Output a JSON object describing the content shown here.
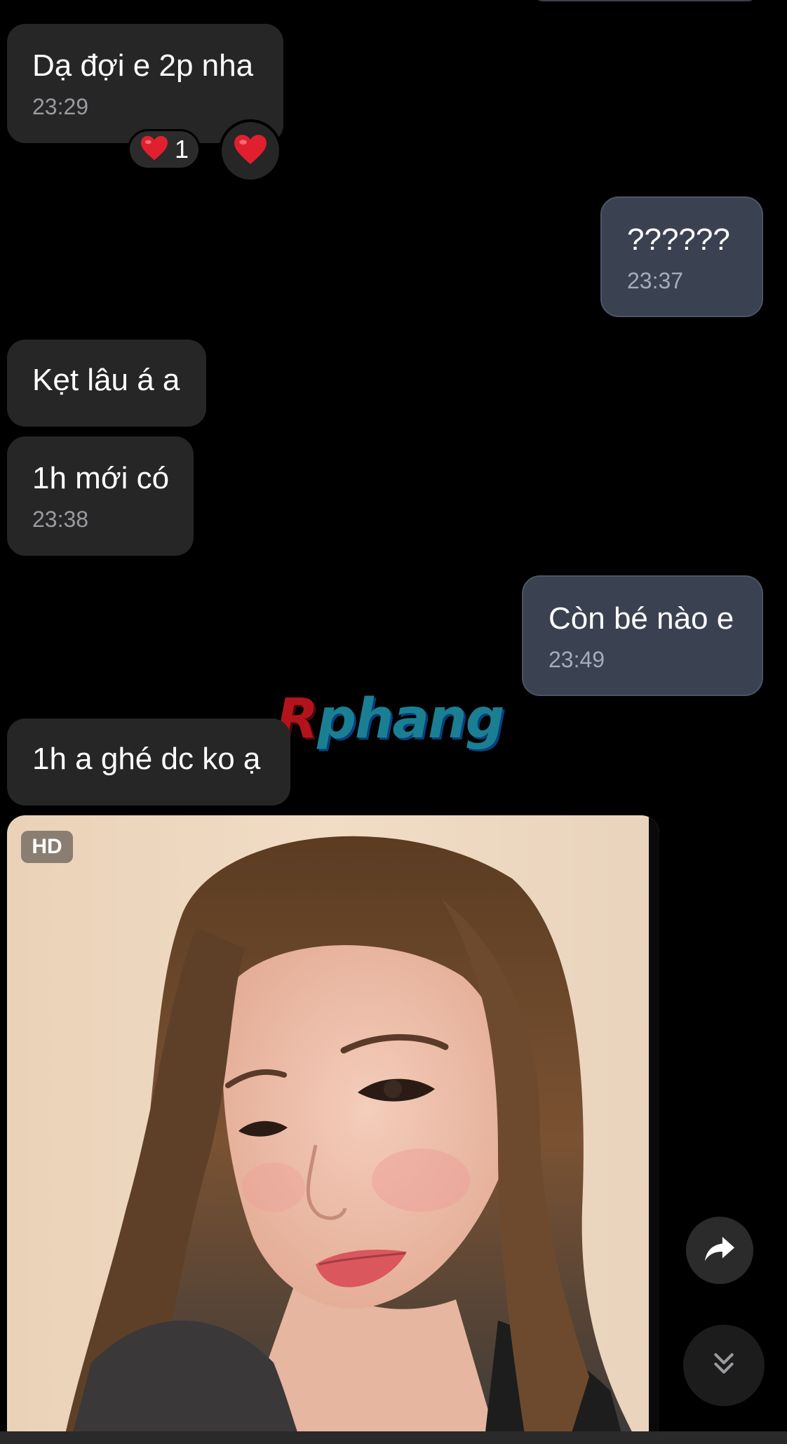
{
  "colors": {
    "background": "#000000",
    "incoming_bubble": "#262626",
    "outgoing_bubble": "#3a4150",
    "timestamp": "#9a9aa0",
    "watermark_red": "#b3141c",
    "watermark_teal": "#1b7f93"
  },
  "messages": [
    {
      "direction": "incoming",
      "text": "Dạ đợi e 2p nha",
      "time": "23:29"
    },
    {
      "direction": "outgoing",
      "text": "??????",
      "time": "23:37"
    },
    {
      "direction": "incoming",
      "text": "Kẹt lâu á a",
      "time": ""
    },
    {
      "direction": "incoming",
      "text": "1h mới có",
      "time": "23:38"
    },
    {
      "direction": "outgoing",
      "text": "Còn bé nào e",
      "time": "23:49"
    },
    {
      "direction": "incoming",
      "text": "1h a ghé dc ko ạ",
      "time": ""
    }
  ],
  "reactions": {
    "emoji_icon": "heart-icon",
    "count": "1"
  },
  "watermark": {
    "first_letter": "R",
    "rest": "phang"
  },
  "photo": {
    "badge": "HD"
  },
  "icons": {
    "share": "share-arrow-icon",
    "scroll": "double-chevron-down-icon"
  }
}
